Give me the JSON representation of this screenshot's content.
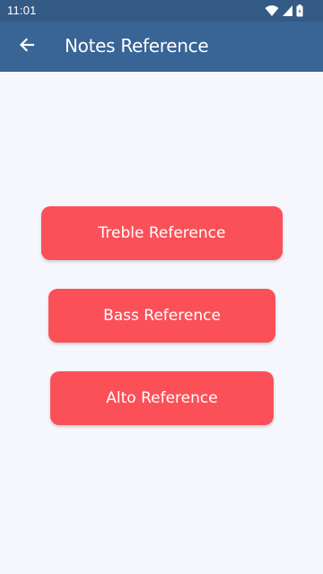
{
  "status_bar": {
    "time": "11:01",
    "icons": [
      "wifi-icon",
      "cell-signal-icon",
      "battery-icon"
    ]
  },
  "app_bar": {
    "back_icon": "arrow-left-icon",
    "title": "Notes Reference"
  },
  "buttons": {
    "treble_label": "Treble Reference",
    "bass_label": "Bass Reference",
    "alto_label": "Alto Reference"
  },
  "colors": {
    "status_bar": "#345a86",
    "app_bar": "#396496",
    "background": "#f5f7fc",
    "button": "#fb5058",
    "button_text": "#ffffff"
  }
}
